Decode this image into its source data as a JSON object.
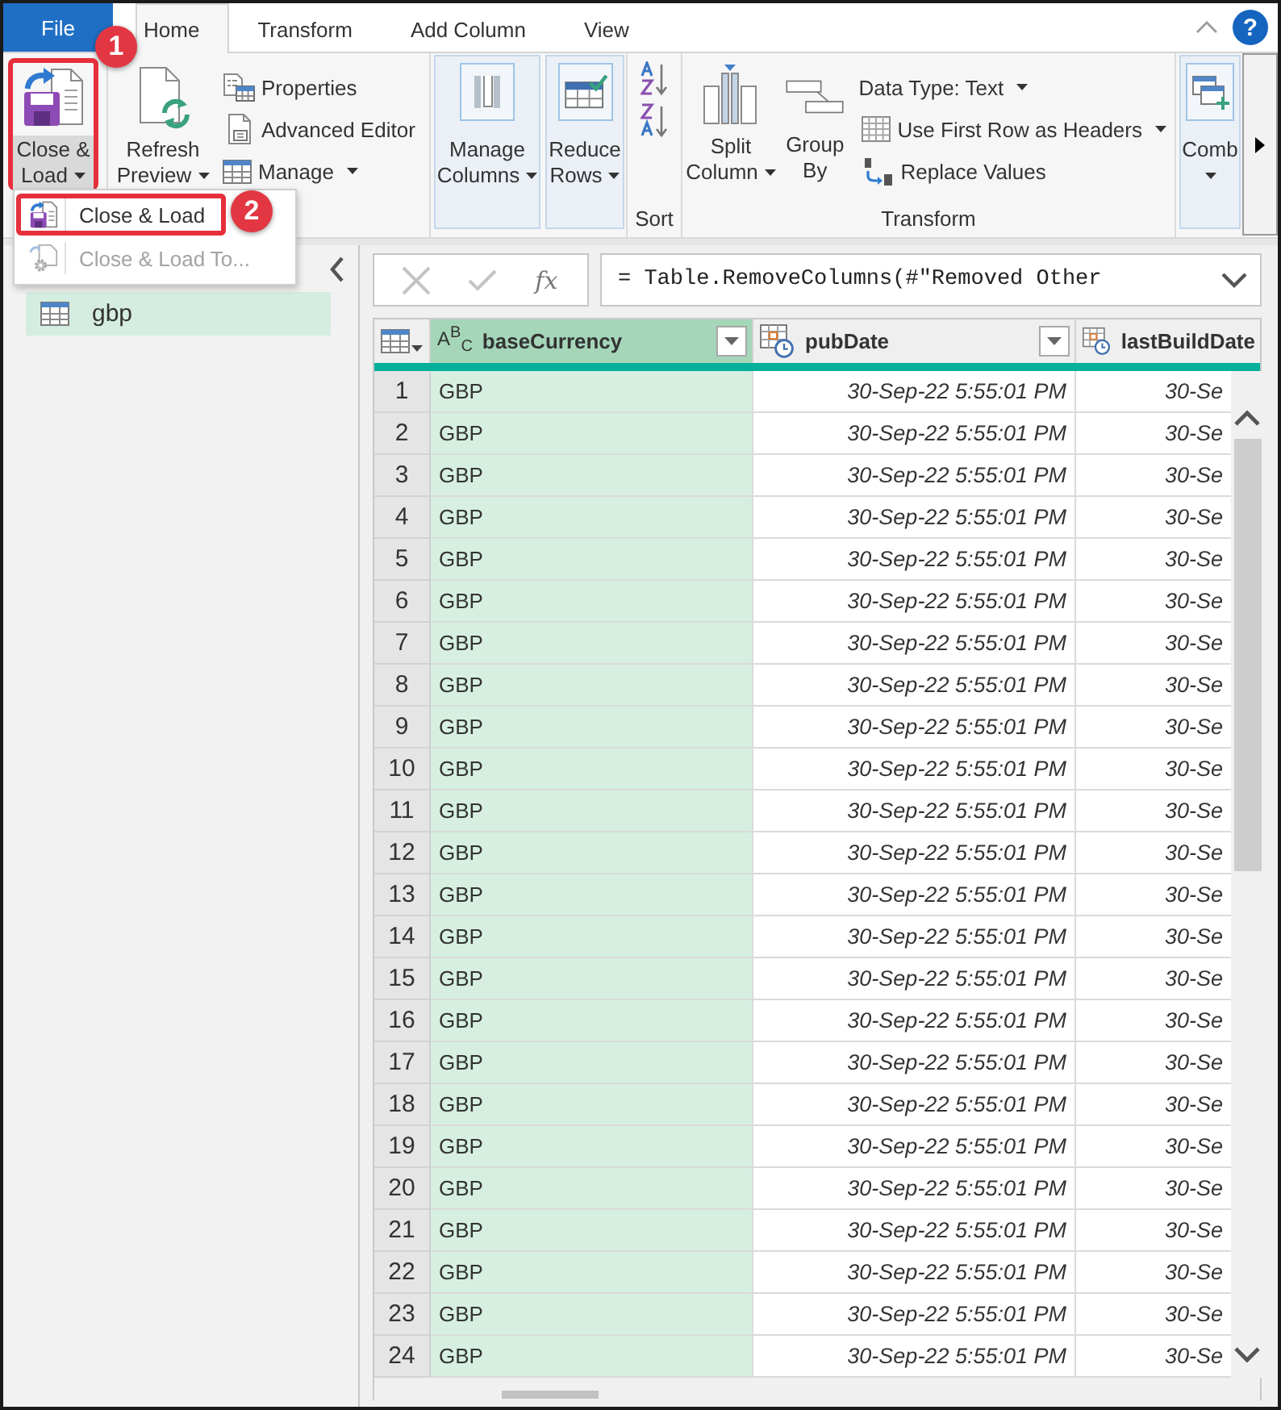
{
  "tabs": [
    {
      "label": "File",
      "kind": "file",
      "selected": false
    },
    {
      "label": "Home",
      "kind": "tab",
      "selected": true
    },
    {
      "label": "Transform",
      "kind": "tab",
      "selected": false
    },
    {
      "label": "Add Column",
      "kind": "tab",
      "selected": false
    },
    {
      "label": "View",
      "kind": "tab",
      "selected": false
    }
  ],
  "help_button": "?",
  "ribbon": {
    "close_load": {
      "lines": [
        "Close &",
        "Load"
      ],
      "dropdown": true,
      "expanded": true,
      "outlined": true
    },
    "refresh_preview": {
      "lines": [
        "Refresh",
        "Preview"
      ],
      "dropdown": true
    },
    "properties": "Properties",
    "advanced_editor": "Advanced Editor",
    "manage": {
      "label": "Manage",
      "dropdown": true
    },
    "manage_columns": {
      "lines": [
        "Manage",
        "Columns"
      ],
      "dropdown": true
    },
    "reduce_rows": {
      "lines": [
        "Reduce",
        "Rows"
      ],
      "dropdown": true
    },
    "sort_group_label": "Sort",
    "split_column": {
      "lines": [
        "Split",
        "Column"
      ],
      "dropdown": true
    },
    "group_by": {
      "lines": [
        "Group",
        "By"
      ],
      "dropdown": false
    },
    "data_type": {
      "label": "Data Type: Text",
      "dropdown": true
    },
    "use_first_row": {
      "label": "Use First Row as Headers",
      "dropdown": true
    },
    "replace_values": "Replace Values",
    "transform_group_label": "Transform",
    "combine": {
      "lines": [
        "Comb"
      ],
      "dropdown": true
    }
  },
  "close_load_menu": {
    "items": [
      {
        "label": "Close & Load",
        "disabled": false,
        "outlined": true
      },
      {
        "label": "Close & Load To...",
        "disabled": true,
        "outlined": false
      }
    ]
  },
  "annotations": [
    {
      "label": "1"
    },
    {
      "label": "2"
    }
  ],
  "queries_pane": {
    "items": [
      {
        "label": "gbp",
        "selected": true
      }
    ]
  },
  "formula_bar": {
    "function_label": "fx",
    "formula": "= Table.RemoveColumns(#\"Removed Other"
  },
  "table": {
    "columns": [
      {
        "name": "baseCurrency",
        "kind": "text",
        "type_badge": "A$^{B}$$_{C}$",
        "selected": true,
        "has_filter": true
      },
      {
        "name": "pubDate",
        "kind": "datetime",
        "selected": false,
        "has_filter": true
      },
      {
        "name": "lastBuildDate",
        "kind": "datetime",
        "selected": false,
        "has_filter": false
      }
    ],
    "rows": [
      {
        "n": "1",
        "cells": [
          "GBP",
          "30-Sep-22 5:55:01 PM",
          "30-Se"
        ]
      },
      {
        "n": "2",
        "cells": [
          "GBP",
          "30-Sep-22 5:55:01 PM",
          "30-Se"
        ]
      },
      {
        "n": "3",
        "cells": [
          "GBP",
          "30-Sep-22 5:55:01 PM",
          "30-Se"
        ]
      },
      {
        "n": "4",
        "cells": [
          "GBP",
          "30-Sep-22 5:55:01 PM",
          "30-Se"
        ]
      },
      {
        "n": "5",
        "cells": [
          "GBP",
          "30-Sep-22 5:55:01 PM",
          "30-Se"
        ]
      },
      {
        "n": "6",
        "cells": [
          "GBP",
          "30-Sep-22 5:55:01 PM",
          "30-Se"
        ]
      },
      {
        "n": "7",
        "cells": [
          "GBP",
          "30-Sep-22 5:55:01 PM",
          "30-Se"
        ]
      },
      {
        "n": "8",
        "cells": [
          "GBP",
          "30-Sep-22 5:55:01 PM",
          "30-Se"
        ]
      },
      {
        "n": "9",
        "cells": [
          "GBP",
          "30-Sep-22 5:55:01 PM",
          "30-Se"
        ]
      },
      {
        "n": "10",
        "cells": [
          "GBP",
          "30-Sep-22 5:55:01 PM",
          "30-Se"
        ]
      },
      {
        "n": "11",
        "cells": [
          "GBP",
          "30-Sep-22 5:55:01 PM",
          "30-Se"
        ]
      },
      {
        "n": "12",
        "cells": [
          "GBP",
          "30-Sep-22 5:55:01 PM",
          "30-Se"
        ]
      },
      {
        "n": "13",
        "cells": [
          "GBP",
          "30-Sep-22 5:55:01 PM",
          "30-Se"
        ]
      },
      {
        "n": "14",
        "cells": [
          "GBP",
          "30-Sep-22 5:55:01 PM",
          "30-Se"
        ]
      },
      {
        "n": "15",
        "cells": [
          "GBP",
          "30-Sep-22 5:55:01 PM",
          "30-Se"
        ]
      },
      {
        "n": "16",
        "cells": [
          "GBP",
          "30-Sep-22 5:55:01 PM",
          "30-Se"
        ]
      },
      {
        "n": "17",
        "cells": [
          "GBP",
          "30-Sep-22 5:55:01 PM",
          "30-Se"
        ]
      },
      {
        "n": "18",
        "cells": [
          "GBP",
          "30-Sep-22 5:55:01 PM",
          "30-Se"
        ]
      },
      {
        "n": "19",
        "cells": [
          "GBP",
          "30-Sep-22 5:55:01 PM",
          "30-Se"
        ]
      },
      {
        "n": "20",
        "cells": [
          "GBP",
          "30-Sep-22 5:55:01 PM",
          "30-Se"
        ]
      },
      {
        "n": "21",
        "cells": [
          "GBP",
          "30-Sep-22 5:55:01 PM",
          "30-Se"
        ]
      },
      {
        "n": "22",
        "cells": [
          "GBP",
          "30-Sep-22 5:55:01 PM",
          "30-Se"
        ]
      },
      {
        "n": "23",
        "cells": [
          "GBP",
          "30-Sep-22 5:55:01 PM",
          "30-Se"
        ]
      },
      {
        "n": "24",
        "cells": [
          "GBP",
          "30-Sep-22 5:55:01 PM",
          "30-Se"
        ]
      }
    ]
  }
}
